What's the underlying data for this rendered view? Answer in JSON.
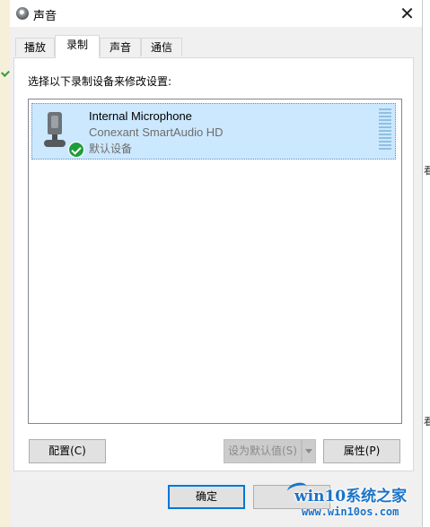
{
  "window": {
    "title": "声音",
    "close_glyph": "✕"
  },
  "tabs": [
    {
      "label": "播放",
      "active": false
    },
    {
      "label": "录制",
      "active": true
    },
    {
      "label": "声音",
      "active": false
    },
    {
      "label": "通信",
      "active": false
    }
  ],
  "recording": {
    "instruction": "选择以下录制设备来修改设置:",
    "devices": [
      {
        "name": "Internal Microphone",
        "driver": "Conexant SmartAudio HD",
        "status": "默认设备",
        "icon": "microphone-icon",
        "badge_icon": "default-check-icon",
        "selected": true,
        "level_bars": 12
      }
    ]
  },
  "panel_buttons": {
    "configure": "配置(C)",
    "set_default": "设为默认值(S)",
    "properties": "属性(P)"
  },
  "dialog_buttons": {
    "ok": "确定",
    "cancel": ""
  },
  "background_fragments": {
    "right_1": "看",
    "right_2": "看"
  },
  "watermark": {
    "title": "win10系统之家",
    "url": "www.win10os.com"
  },
  "colors": {
    "selection": "#cce8ff",
    "accent": "#0078d7",
    "check_green": "#1f9d3b",
    "watermark_blue": "#1a73c7"
  }
}
